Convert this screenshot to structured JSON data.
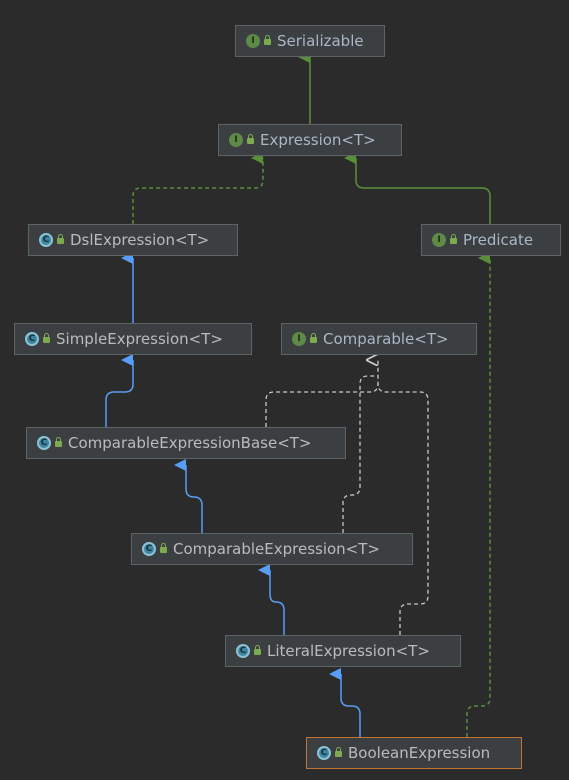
{
  "nodes": {
    "serializable": {
      "label": "Serializable",
      "kind": "interface",
      "icon": "interface-icon"
    },
    "expression": {
      "label": "Expression<T>",
      "kind": "interface",
      "icon": "interface-icon"
    },
    "dsl_expression": {
      "label": "DslExpression<T>",
      "kind": "class",
      "icon": "abstract-class-icon"
    },
    "predicate": {
      "label": "Predicate",
      "kind": "interface",
      "icon": "interface-icon"
    },
    "simple_expression": {
      "label": "SimpleExpression<T>",
      "kind": "class",
      "icon": "abstract-class-icon"
    },
    "comparable": {
      "label": "Comparable<T>",
      "kind": "interface",
      "icon": "interface-icon"
    },
    "comparable_expression_base": {
      "label": "ComparableExpressionBase<T>",
      "kind": "class",
      "icon": "abstract-class-icon"
    },
    "comparable_expression": {
      "label": "ComparableExpression<T>",
      "kind": "class",
      "icon": "abstract-class-icon"
    },
    "literal_expression": {
      "label": "LiteralExpression<T>",
      "kind": "class",
      "icon": "abstract-class-icon"
    },
    "boolean_expression": {
      "label": "BooleanExpression",
      "kind": "class",
      "icon": "abstract-class-icon",
      "selected": true
    }
  },
  "icon_letters": {
    "interface": "I",
    "class": "C"
  },
  "colors": {
    "background": "#2b2b2b",
    "extends_edge": "#589df6",
    "implements_edge_green": "#5a8f3a",
    "implements_edge_white": "#c8c8c8",
    "selected_border": "#c27431"
  }
}
